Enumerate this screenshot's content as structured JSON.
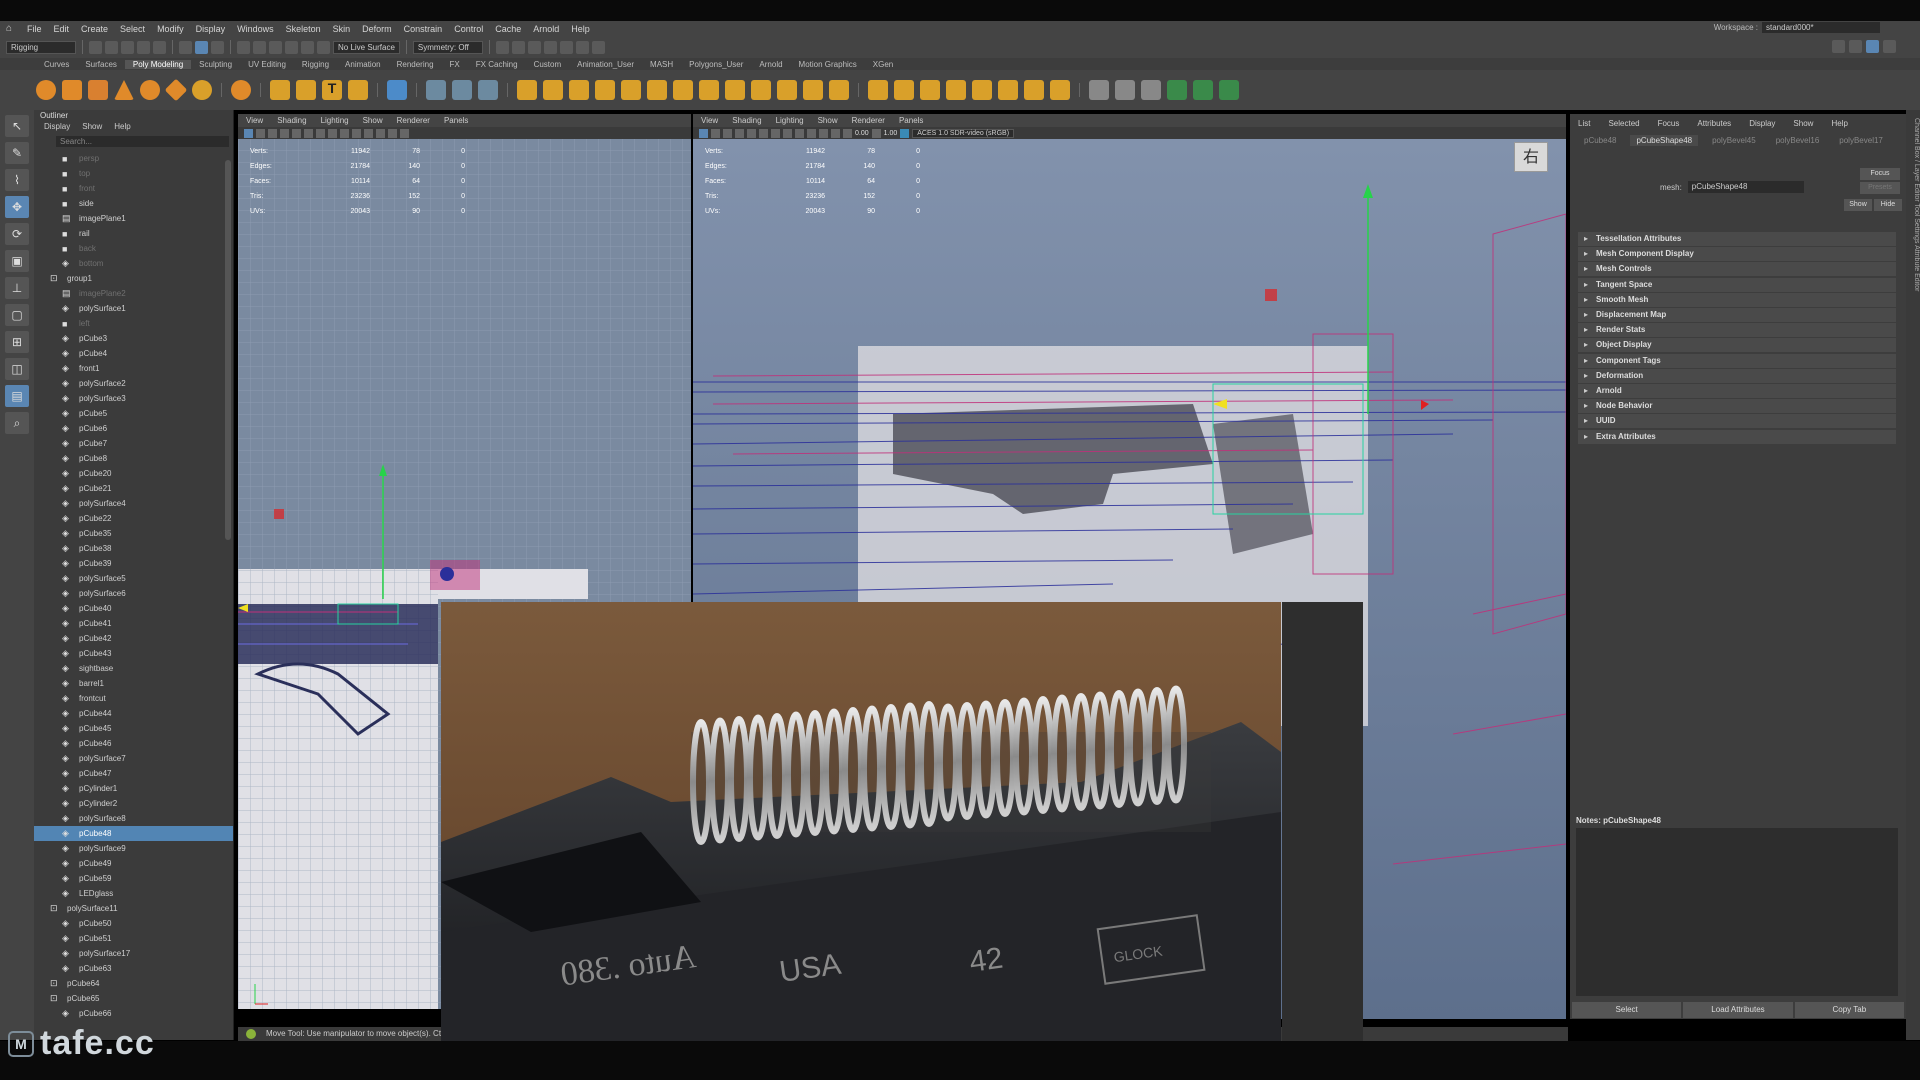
{
  "menu": [
    "File",
    "Edit",
    "Create",
    "Select",
    "Modify",
    "Display",
    "Windows",
    "Skeleton",
    "Skin",
    "Deform",
    "Constrain",
    "Control",
    "Cache",
    "Arnold",
    "Help"
  ],
  "workspace": {
    "label": "Workspace :",
    "value": "standard000*"
  },
  "statusline": {
    "mode": "Rigging",
    "live": "No Live Surface",
    "symmetry": "Symmetry: Off"
  },
  "shelf_tabs": [
    "Curves",
    "Surfaces",
    "Poly Modeling",
    "Sculpting",
    "UV Editing",
    "Rigging",
    "Animation",
    "Rendering",
    "FX",
    "FX Caching",
    "Custom",
    "Animation_User",
    "MASH",
    "Polygons_User",
    "Arnold",
    "Motion Graphics",
    "XGen"
  ],
  "shelf_active": "Poly Modeling",
  "shelf_colors": {
    "orange": "#e08a2a",
    "gold": "#d9a02a",
    "blue": "#4c8bc9",
    "gray": "#8a8a8a"
  },
  "outliner": {
    "title": "Outliner",
    "menu": [
      "Display",
      "Show",
      "Help"
    ],
    "search_placeholder": "Search...",
    "items": [
      {
        "label": "persp",
        "dim": true,
        "icon": "camera-icon"
      },
      {
        "label": "top",
        "dim": true,
        "icon": "camera-icon"
      },
      {
        "label": "front",
        "dim": true,
        "icon": "camera-icon"
      },
      {
        "label": "side",
        "dim": false,
        "icon": "camera-icon"
      },
      {
        "label": "imagePlane1",
        "dim": false,
        "icon": "image-plane-icon"
      },
      {
        "label": "rail",
        "dim": false,
        "icon": "camera-icon"
      },
      {
        "label": "back",
        "dim": true,
        "icon": "camera-icon"
      },
      {
        "label": "bottom",
        "dim": true,
        "icon": "mesh-icon"
      },
      {
        "label": "group1",
        "dim": false,
        "icon": "group-icon"
      },
      {
        "label": "imagePlane2",
        "dim": true,
        "icon": "image-plane-icon"
      },
      {
        "label": "polySurface1",
        "dim": false,
        "icon": "mesh-icon"
      },
      {
        "label": "left",
        "dim": true,
        "icon": "camera-icon"
      },
      {
        "label": "pCube3",
        "dim": false,
        "icon": "mesh-icon"
      },
      {
        "label": "pCube4",
        "dim": false,
        "icon": "mesh-icon"
      },
      {
        "label": "front1",
        "dim": false,
        "icon": "mesh-icon"
      },
      {
        "label": "polySurface2",
        "dim": false,
        "icon": "mesh-icon"
      },
      {
        "label": "polySurface3",
        "dim": false,
        "icon": "mesh-icon"
      },
      {
        "label": "pCube5",
        "dim": false,
        "icon": "mesh-icon"
      },
      {
        "label": "pCube6",
        "dim": false,
        "icon": "mesh-icon"
      },
      {
        "label": "pCube7",
        "dim": false,
        "icon": "mesh-icon"
      },
      {
        "label": "pCube8",
        "dim": false,
        "icon": "mesh-icon"
      },
      {
        "label": "pCube20",
        "dim": false,
        "icon": "mesh-icon"
      },
      {
        "label": "pCube21",
        "dim": false,
        "icon": "mesh-icon"
      },
      {
        "label": "polySurface4",
        "dim": false,
        "icon": "mesh-icon"
      },
      {
        "label": "pCube22",
        "dim": false,
        "icon": "mesh-icon"
      },
      {
        "label": "pCube35",
        "dim": false,
        "icon": "mesh-icon"
      },
      {
        "label": "pCube38",
        "dim": false,
        "icon": "mesh-icon"
      },
      {
        "label": "pCube39",
        "dim": false,
        "icon": "mesh-icon"
      },
      {
        "label": "polySurface5",
        "dim": false,
        "icon": "mesh-icon"
      },
      {
        "label": "polySurface6",
        "dim": false,
        "icon": "mesh-icon"
      },
      {
        "label": "pCube40",
        "dim": false,
        "icon": "mesh-icon"
      },
      {
        "label": "pCube41",
        "dim": false,
        "icon": "mesh-icon"
      },
      {
        "label": "pCube42",
        "dim": false,
        "icon": "mesh-icon"
      },
      {
        "label": "pCube43",
        "dim": false,
        "icon": "mesh-icon"
      },
      {
        "label": "sightbase",
        "dim": false,
        "icon": "mesh-icon"
      },
      {
        "label": "barrel1",
        "dim": false,
        "icon": "mesh-icon"
      },
      {
        "label": "frontcut",
        "dim": false,
        "icon": "mesh-icon"
      },
      {
        "label": "pCube44",
        "dim": false,
        "icon": "mesh-icon"
      },
      {
        "label": "pCube45",
        "dim": false,
        "icon": "mesh-icon"
      },
      {
        "label": "pCube46",
        "dim": false,
        "icon": "mesh-icon"
      },
      {
        "label": "polySurface7",
        "dim": false,
        "icon": "mesh-icon"
      },
      {
        "label": "pCube47",
        "dim": false,
        "icon": "mesh-icon"
      },
      {
        "label": "pCylinder1",
        "dim": false,
        "icon": "mesh-icon"
      },
      {
        "label": "pCylinder2",
        "dim": false,
        "icon": "mesh-icon"
      },
      {
        "label": "polySurface8",
        "dim": false,
        "icon": "mesh-icon"
      },
      {
        "label": "pCube48",
        "dim": false,
        "icon": "mesh-icon",
        "selected": true
      },
      {
        "label": "polySurface9",
        "dim": false,
        "icon": "mesh-icon"
      },
      {
        "label": "pCube49",
        "dim": false,
        "icon": "mesh-icon"
      },
      {
        "label": "pCube59",
        "dim": false,
        "icon": "mesh-icon"
      },
      {
        "label": "LEDglass",
        "dim": false,
        "icon": "mesh-icon"
      },
      {
        "label": "polySurface11",
        "dim": false,
        "icon": "group-icon"
      },
      {
        "label": "pCube50",
        "dim": false,
        "icon": "mesh-icon"
      },
      {
        "label": "pCube51",
        "dim": false,
        "icon": "mesh-icon"
      },
      {
        "label": "polySurface17",
        "dim": false,
        "icon": "mesh-icon"
      },
      {
        "label": "pCube63",
        "dim": false,
        "icon": "mesh-icon"
      },
      {
        "label": "pCube64",
        "dim": false,
        "icon": "group-icon"
      },
      {
        "label": "pCube65",
        "dim": false,
        "icon": "group-icon"
      },
      {
        "label": "pCube66",
        "dim": false,
        "icon": "mesh-icon"
      }
    ]
  },
  "viewport_menu": [
    "View",
    "Shading",
    "Lighting",
    "Show",
    "Renderer",
    "Panels"
  ],
  "hud": [
    {
      "k": "Verts:",
      "a": "11942",
      "b": "78",
      "c": "0"
    },
    {
      "k": "Edges:",
      "a": "21784",
      "b": "140",
      "c": "0"
    },
    {
      "k": "Faces:",
      "a": "10114",
      "b": "64",
      "c": "0"
    },
    {
      "k": "Tris:",
      "a": "23236",
      "b": "152",
      "c": "0"
    },
    {
      "k": "UVs:",
      "a": "20043",
      "b": "90",
      "c": "0"
    }
  ],
  "viewport_right": {
    "exposure": "0.00",
    "gamma": "1.00",
    "colorspace": "ACES 1.0 SDR-video (sRGB)",
    "viewcube": "右"
  },
  "attribute_editor": {
    "menu": [
      "List",
      "Selected",
      "Focus",
      "Attributes",
      "Display",
      "Show",
      "Help"
    ],
    "tabs": [
      "pCube48",
      "pCubeShape48",
      "polyBevel45",
      "polyBevel16",
      "polyBevel17"
    ],
    "active_tab": "pCubeShape48",
    "mesh_label": "mesh:",
    "mesh_value": "pCubeShape48",
    "focus": "Focus",
    "presets": "Presets",
    "show": "Show",
    "hide": "Hide",
    "sections": [
      "Tessellation Attributes",
      "Mesh Component Display",
      "Mesh Controls",
      "Tangent Space",
      "Smooth Mesh",
      "Displacement Map",
      "Render Stats",
      "Object Display",
      "Component Tags",
      "Deformation",
      "Arnold",
      "Node Behavior",
      "UUID",
      "Extra Attributes"
    ],
    "notes_label": "Notes: pCubeShape48",
    "buttons": [
      "Select",
      "Load Attributes",
      "Copy Tab"
    ]
  },
  "side_strip": "Channel Box / Layer Editor    Tool Settings    Attribute Editor",
  "helpline": "Move Tool: Use manipulator to move object(s). Ctrl+",
  "photo_text": {
    "left": "Auto .380",
    "mid": "USA",
    "num": "42",
    "box": "GLOCK"
  },
  "colors": {
    "selection": "#5285b4",
    "viewport_bg": "#7486a3",
    "wire_blue": "#2a2f9a",
    "wire_magenta": "#c0307a",
    "manip_green": "#27d34a",
    "manip_red": "#e02020",
    "manip_yellow": "#f0e020"
  },
  "watermark": "tafe.cc"
}
